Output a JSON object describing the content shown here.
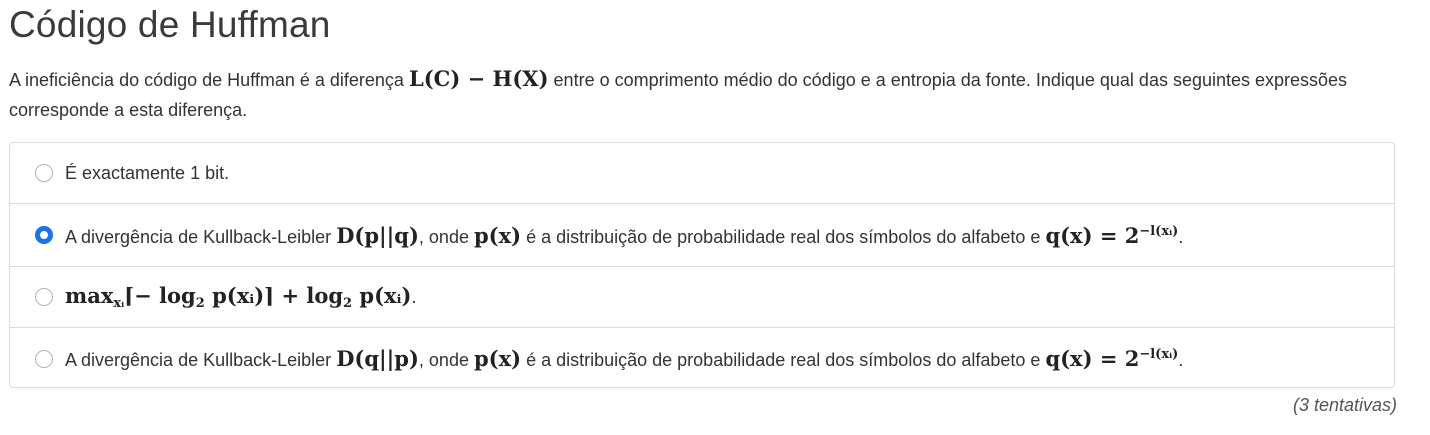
{
  "title": "Código de Huffman",
  "question": {
    "pre": "A ineficiência do código de Huffman é a diferença",
    "math": "L(C) − H(X)",
    "post": "entre o comprimento médio do código e a entropia da fonte. Indique qual das seguintes expressões corresponde a esta diferença."
  },
  "options": [
    {
      "text": "É exactamente 1 bit.",
      "selected": false
    },
    {
      "pre": "A divergência de Kullback-Leibler",
      "math1": "D(p||q)",
      "mid1": ", onde",
      "math2": "p(x)",
      "mid2": "é a distribuição de probabilidade real dos símbolos do alfabeto e",
      "math3": "q(x) = 2",
      "exp": "−l(xᵢ)",
      "end": ".",
      "selected": true
    },
    {
      "max": "max",
      "max_sub": "xᵢ",
      "expr": "⌈− log",
      "base": "2",
      "expr2": "p(xᵢ)⌉ + log",
      "base2": "2",
      "expr3": "p(xᵢ)",
      "end": ".",
      "selected": false
    },
    {
      "pre": "A divergência de Kullback-Leibler",
      "math1": "D(q||p)",
      "mid1": ", onde",
      "math2": "p(x)",
      "mid2": "é a distribuição de probabilidade real dos símbolos do alfabeto e",
      "math3": "q(x) = 2",
      "exp": "−l(xᵢ)",
      "end": ".",
      "selected": false
    }
  ],
  "attempts": "(3 tentativas)",
  "colors": {
    "accent": "#1a73e8",
    "border": "#dcdcdc",
    "text": "#333333"
  }
}
